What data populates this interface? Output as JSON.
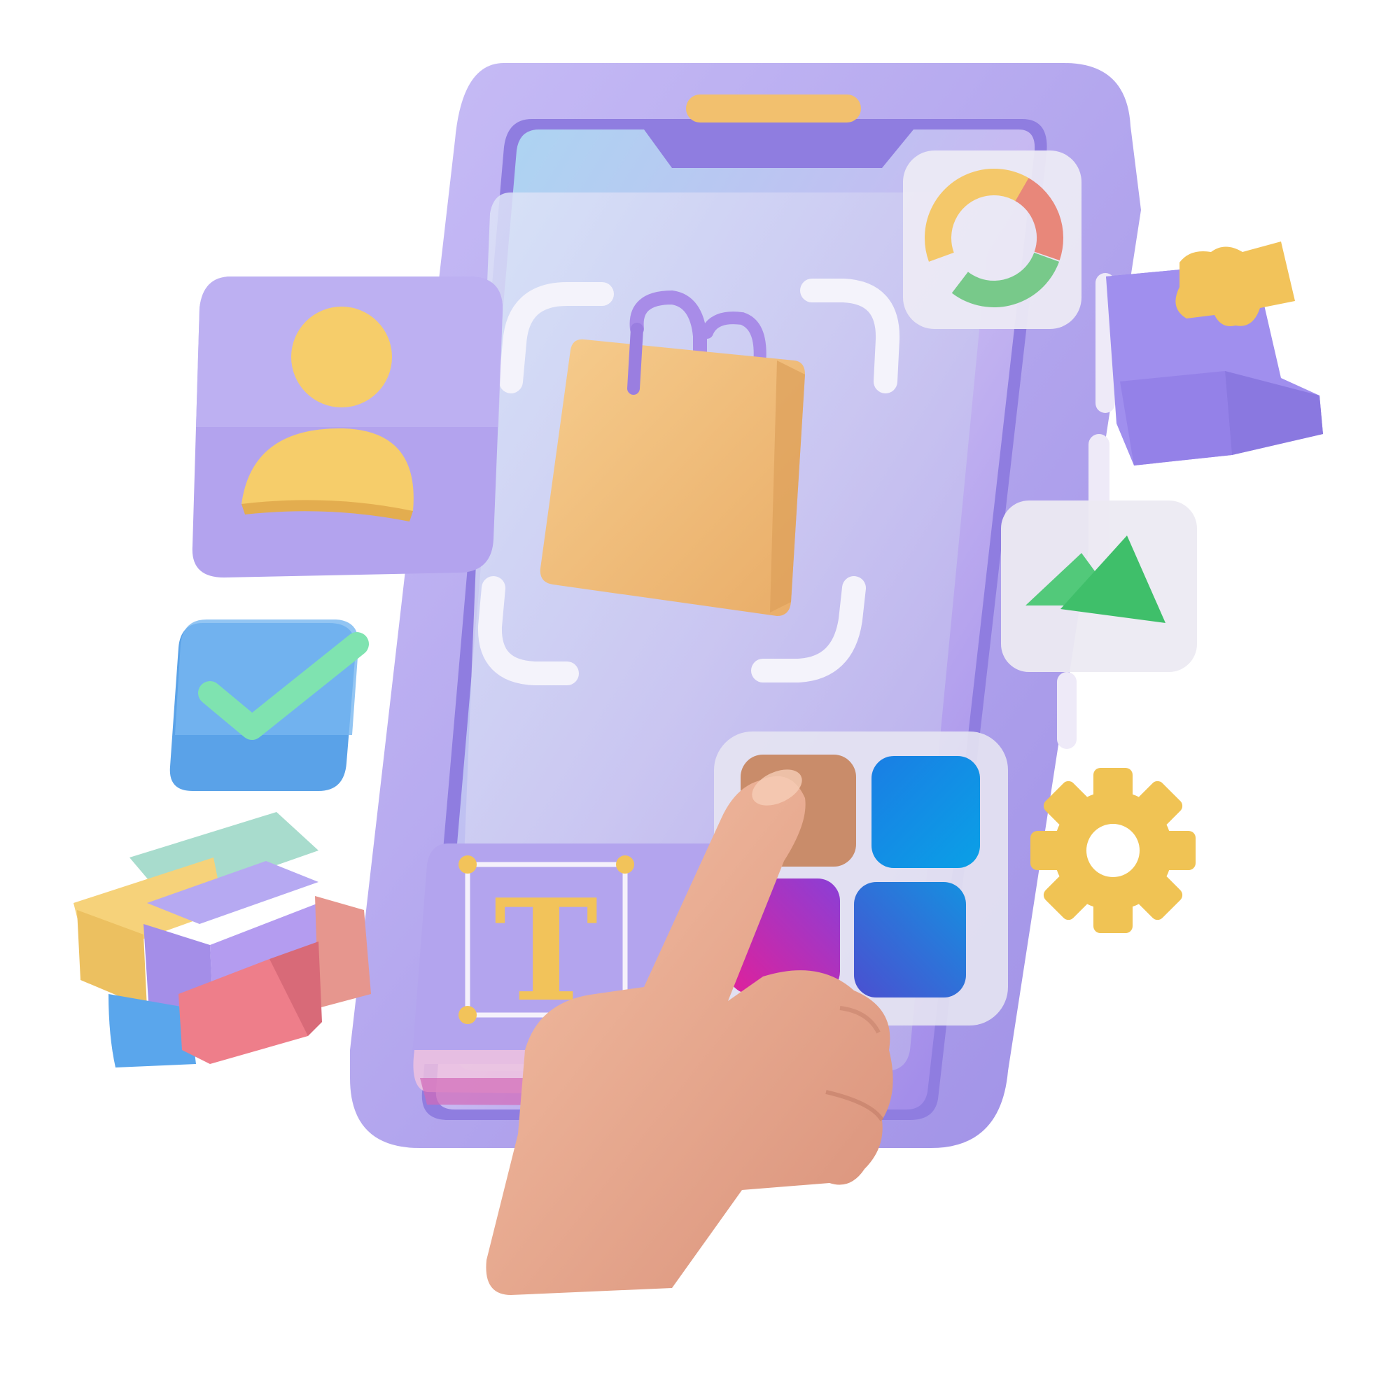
{
  "illustration": {
    "text_icon_letter": "T",
    "icons": [
      "phone-icon",
      "shopping-bag-icon",
      "scan-frame-icon",
      "user-icon",
      "checkmark-icon",
      "cube-blocks-icon",
      "donut-chart-icon",
      "puzzle-icon",
      "image-icon",
      "gear-icon",
      "text-tool-icon",
      "app-grid-icon",
      "pointing-hand-icon"
    ]
  },
  "colors": {
    "phone_body": "#b3a6ee",
    "phone_screen": "#c9c0f5",
    "accent_yellow": "#f2c35a",
    "bag_orange": "#f1bd78",
    "check_green": "#7fe3b0",
    "check_box_blue": "#6fb0f0",
    "tile_blue": "#1f8de0",
    "tile_brown": "#c98c6a",
    "tile_magenta": "#c42fb6",
    "tile_indigo": "#3f6ad8",
    "skin": "#e8a98a"
  }
}
